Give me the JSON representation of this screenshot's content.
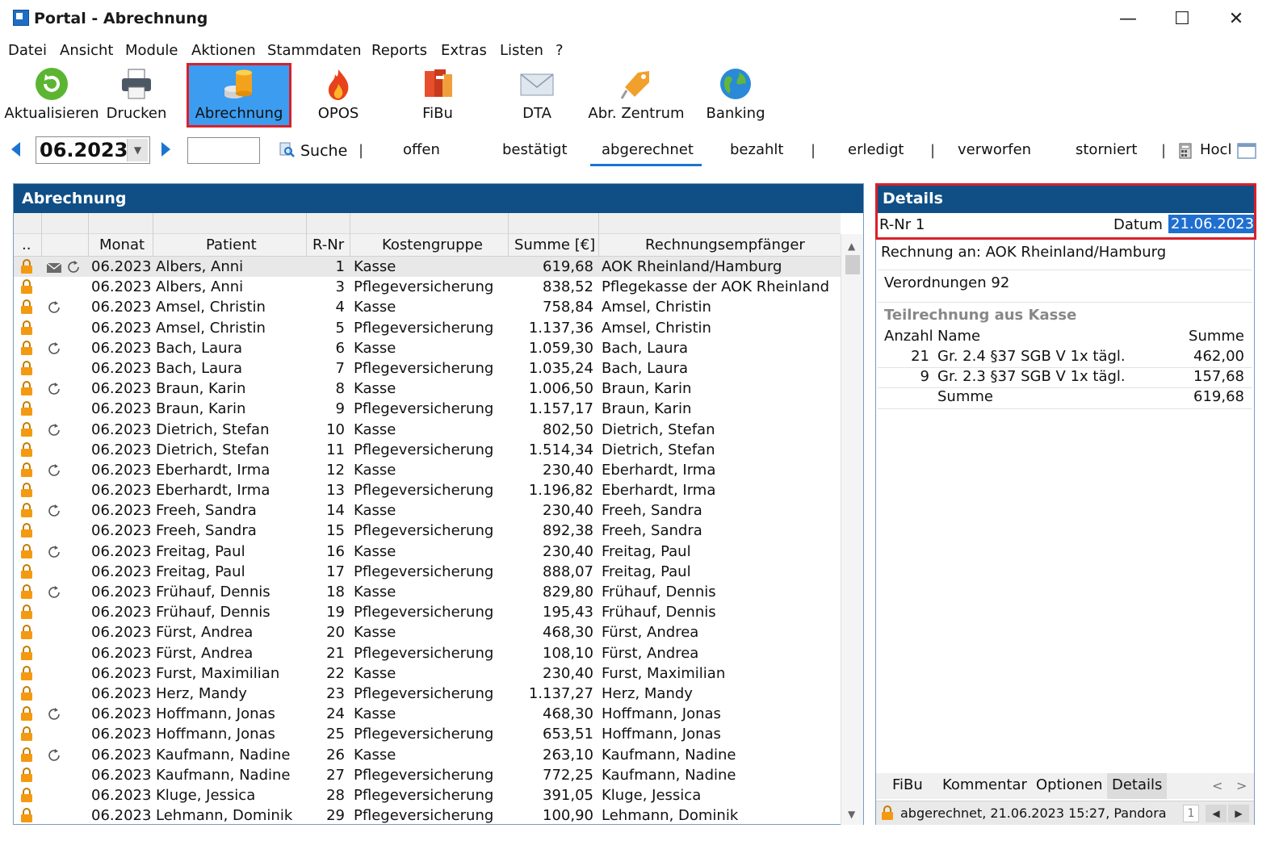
{
  "window": {
    "title": "Portal - Abrechnung",
    "minimize": "—",
    "maximize": "☐",
    "close": "✕"
  },
  "menu": [
    "Datei",
    "Ansicht",
    "Module",
    "Aktionen",
    "Stammdaten",
    "Reports",
    "Extras",
    "Listen",
    "?"
  ],
  "toolbar": [
    {
      "label": "Aktualisieren",
      "icon": "refresh-icon"
    },
    {
      "label": "Drucken",
      "icon": "printer-icon"
    },
    {
      "label": "Abrechnung",
      "icon": "coins-icon",
      "active": true
    },
    {
      "label": "OPOS",
      "icon": "flame-icon"
    },
    {
      "label": "FiBu",
      "icon": "books-icon"
    },
    {
      "label": "DTA",
      "icon": "envelope-icon"
    },
    {
      "label": "Abr. Zentrum",
      "icon": "tag-icon"
    },
    {
      "label": "Banking",
      "icon": "globe-icon"
    }
  ],
  "filter": {
    "month": "06.2023",
    "search_value": "",
    "search_label": "Suche",
    "tabs": [
      "offen",
      "bestätigt",
      "abgerechnet",
      "bezahlt",
      "erledigt",
      "verworfen",
      "storniert",
      "Hocl"
    ],
    "selected_tab": "abgerechnet"
  },
  "abrechnung": {
    "title": "Abrechnung",
    "columns": {
      "dots": "..",
      "monat": "Monat",
      "patient": "Patient",
      "rnr": "R-Nr",
      "kostengruppe": "Kostengruppe",
      "summe": "Summe [€]",
      "empfaenger": "Rechnungsempfänger"
    },
    "rows": [
      {
        "monat": "06.2023",
        "patient": "Albers, Anni",
        "rnr": "1",
        "kg": "Kasse",
        "summe": "619,68",
        "emp": "AOK Rheinland/Hamburg",
        "mail": true,
        "cycle": true
      },
      {
        "monat": "06.2023",
        "patient": "Albers, Anni",
        "rnr": "3",
        "kg": "Pflegeversicherung",
        "summe": "838,52",
        "emp": "Pflegekasse der AOK Rheinland",
        "mail": false,
        "cycle": false
      },
      {
        "monat": "06.2023",
        "patient": "Amsel, Christin",
        "rnr": "4",
        "kg": "Kasse",
        "summe": "758,84",
        "emp": "Amsel, Christin",
        "mail": false,
        "cycle": true
      },
      {
        "monat": "06.2023",
        "patient": "Amsel, Christin",
        "rnr": "5",
        "kg": "Pflegeversicherung",
        "summe": "1.137,36",
        "emp": "Amsel, Christin",
        "mail": false,
        "cycle": false
      },
      {
        "monat": "06.2023",
        "patient": "Bach, Laura",
        "rnr": "6",
        "kg": "Kasse",
        "summe": "1.059,30",
        "emp": "Bach, Laura",
        "mail": false,
        "cycle": true
      },
      {
        "monat": "06.2023",
        "patient": "Bach, Laura",
        "rnr": "7",
        "kg": "Pflegeversicherung",
        "summe": "1.035,24",
        "emp": "Bach, Laura",
        "mail": false,
        "cycle": false
      },
      {
        "monat": "06.2023",
        "patient": "Braun, Karin",
        "rnr": "8",
        "kg": "Kasse",
        "summe": "1.006,50",
        "emp": "Braun, Karin",
        "mail": false,
        "cycle": true
      },
      {
        "monat": "06.2023",
        "patient": "Braun, Karin",
        "rnr": "9",
        "kg": "Pflegeversicherung",
        "summe": "1.157,17",
        "emp": "Braun, Karin",
        "mail": false,
        "cycle": false
      },
      {
        "monat": "06.2023",
        "patient": "Dietrich, Stefan",
        "rnr": "10",
        "kg": "Kasse",
        "summe": "802,50",
        "emp": "Dietrich, Stefan",
        "mail": false,
        "cycle": true
      },
      {
        "monat": "06.2023",
        "patient": "Dietrich, Stefan",
        "rnr": "11",
        "kg": "Pflegeversicherung",
        "summe": "1.514,34",
        "emp": "Dietrich, Stefan",
        "mail": false,
        "cycle": false
      },
      {
        "monat": "06.2023",
        "patient": "Eberhardt, Irma",
        "rnr": "12",
        "kg": "Kasse",
        "summe": "230,40",
        "emp": "Eberhardt, Irma",
        "mail": false,
        "cycle": true
      },
      {
        "monat": "06.2023",
        "patient": "Eberhardt, Irma",
        "rnr": "13",
        "kg": "Pflegeversicherung",
        "summe": "1.196,82",
        "emp": "Eberhardt, Irma",
        "mail": false,
        "cycle": false
      },
      {
        "monat": "06.2023",
        "patient": "Freeh, Sandra",
        "rnr": "14",
        "kg": "Kasse",
        "summe": "230,40",
        "emp": "Freeh, Sandra",
        "mail": false,
        "cycle": true
      },
      {
        "monat": "06.2023",
        "patient": "Freeh, Sandra",
        "rnr": "15",
        "kg": "Pflegeversicherung",
        "summe": "892,38",
        "emp": "Freeh, Sandra",
        "mail": false,
        "cycle": false
      },
      {
        "monat": "06.2023",
        "patient": "Freitag, Paul",
        "rnr": "16",
        "kg": "Kasse",
        "summe": "230,40",
        "emp": "Freitag, Paul",
        "mail": false,
        "cycle": true
      },
      {
        "monat": "06.2023",
        "patient": "Freitag, Paul",
        "rnr": "17",
        "kg": "Pflegeversicherung",
        "summe": "888,07",
        "emp": "Freitag, Paul",
        "mail": false,
        "cycle": false
      },
      {
        "monat": "06.2023",
        "patient": "Frühauf, Dennis",
        "rnr": "18",
        "kg": "Kasse",
        "summe": "829,80",
        "emp": "Frühauf, Dennis",
        "mail": false,
        "cycle": true
      },
      {
        "monat": "06.2023",
        "patient": "Frühauf, Dennis",
        "rnr": "19",
        "kg": "Pflegeversicherung",
        "summe": "195,43",
        "emp": "Frühauf, Dennis",
        "mail": false,
        "cycle": false
      },
      {
        "monat": "06.2023",
        "patient": "Fürst, Andrea",
        "rnr": "20",
        "kg": "Kasse",
        "summe": "468,30",
        "emp": "Fürst, Andrea",
        "mail": false,
        "cycle": false
      },
      {
        "monat": "06.2023",
        "patient": "Fürst, Andrea",
        "rnr": "21",
        "kg": "Pflegeversicherung",
        "summe": "108,10",
        "emp": "Fürst, Andrea",
        "mail": false,
        "cycle": false
      },
      {
        "monat": "06.2023",
        "patient": "Furst, Maximilian",
        "rnr": "22",
        "kg": "Kasse",
        "summe": "230,40",
        "emp": "Furst, Maximilian",
        "mail": false,
        "cycle": false
      },
      {
        "monat": "06.2023",
        "patient": "Herz, Mandy",
        "rnr": "23",
        "kg": "Pflegeversicherung",
        "summe": "1.137,27",
        "emp": "Herz, Mandy",
        "mail": false,
        "cycle": false
      },
      {
        "monat": "06.2023",
        "patient": "Hoffmann, Jonas",
        "rnr": "24",
        "kg": "Kasse",
        "summe": "468,30",
        "emp": "Hoffmann, Jonas",
        "mail": false,
        "cycle": true
      },
      {
        "monat": "06.2023",
        "patient": "Hoffmann, Jonas",
        "rnr": "25",
        "kg": "Pflegeversicherung",
        "summe": "653,51",
        "emp": "Hoffmann, Jonas",
        "mail": false,
        "cycle": false
      },
      {
        "monat": "06.2023",
        "patient": "Kaufmann, Nadine",
        "rnr": "26",
        "kg": "Kasse",
        "summe": "263,10",
        "emp": "Kaufmann, Nadine",
        "mail": false,
        "cycle": true
      },
      {
        "monat": "06.2023",
        "patient": "Kaufmann, Nadine",
        "rnr": "27",
        "kg": "Pflegeversicherung",
        "summe": "772,25",
        "emp": "Kaufmann, Nadine",
        "mail": false,
        "cycle": false
      },
      {
        "monat": "06.2023",
        "patient": "Kluge, Jessica",
        "rnr": "28",
        "kg": "Pflegeversicherung",
        "summe": "391,05",
        "emp": "Kluge, Jessica",
        "mail": false,
        "cycle": false
      },
      {
        "monat": "06.2023",
        "patient": "Lehmann, Dominik",
        "rnr": "29",
        "kg": "Pflegeversicherung",
        "summe": "100,90",
        "emp": "Lehmann, Dominik",
        "mail": false,
        "cycle": false
      }
    ]
  },
  "details": {
    "title": "Details",
    "rnr_label": "R-Nr 1",
    "datum_label": "Datum",
    "datum_value": "21.06.2023",
    "rechnung_an": "Rechnung an: AOK Rheinland/Hamburg",
    "verordnungen": "Verordnungen 92",
    "teilrechnung": "Teilrechnung aus Kasse",
    "table_head": {
      "anzahl": "Anzahl",
      "name": "Name",
      "summe": "Summe"
    },
    "table_rows": [
      {
        "anzahl": "21",
        "name": "Gr. 2.4 §37 SGB V 1x tägl.",
        "summe": "462,00"
      },
      {
        "anzahl": "9",
        "name": "Gr. 2.3 §37 SGB V 1x tägl.",
        "summe": "157,68"
      },
      {
        "anzahl": "",
        "name": "Summe",
        "summe": "619,68"
      }
    ],
    "tabs": [
      "FiBu",
      "Kommentar",
      "Optionen",
      "Details"
    ],
    "selected_tab": "Details",
    "status": "abgerechnet, 21.06.2023 15:27, Pandora",
    "page": "1"
  },
  "colors": {
    "header_blue": "#0f4f86",
    "accent": "#1a74d0",
    "highlight_red": "#d9202a",
    "lock_orange": "#f39a12"
  }
}
